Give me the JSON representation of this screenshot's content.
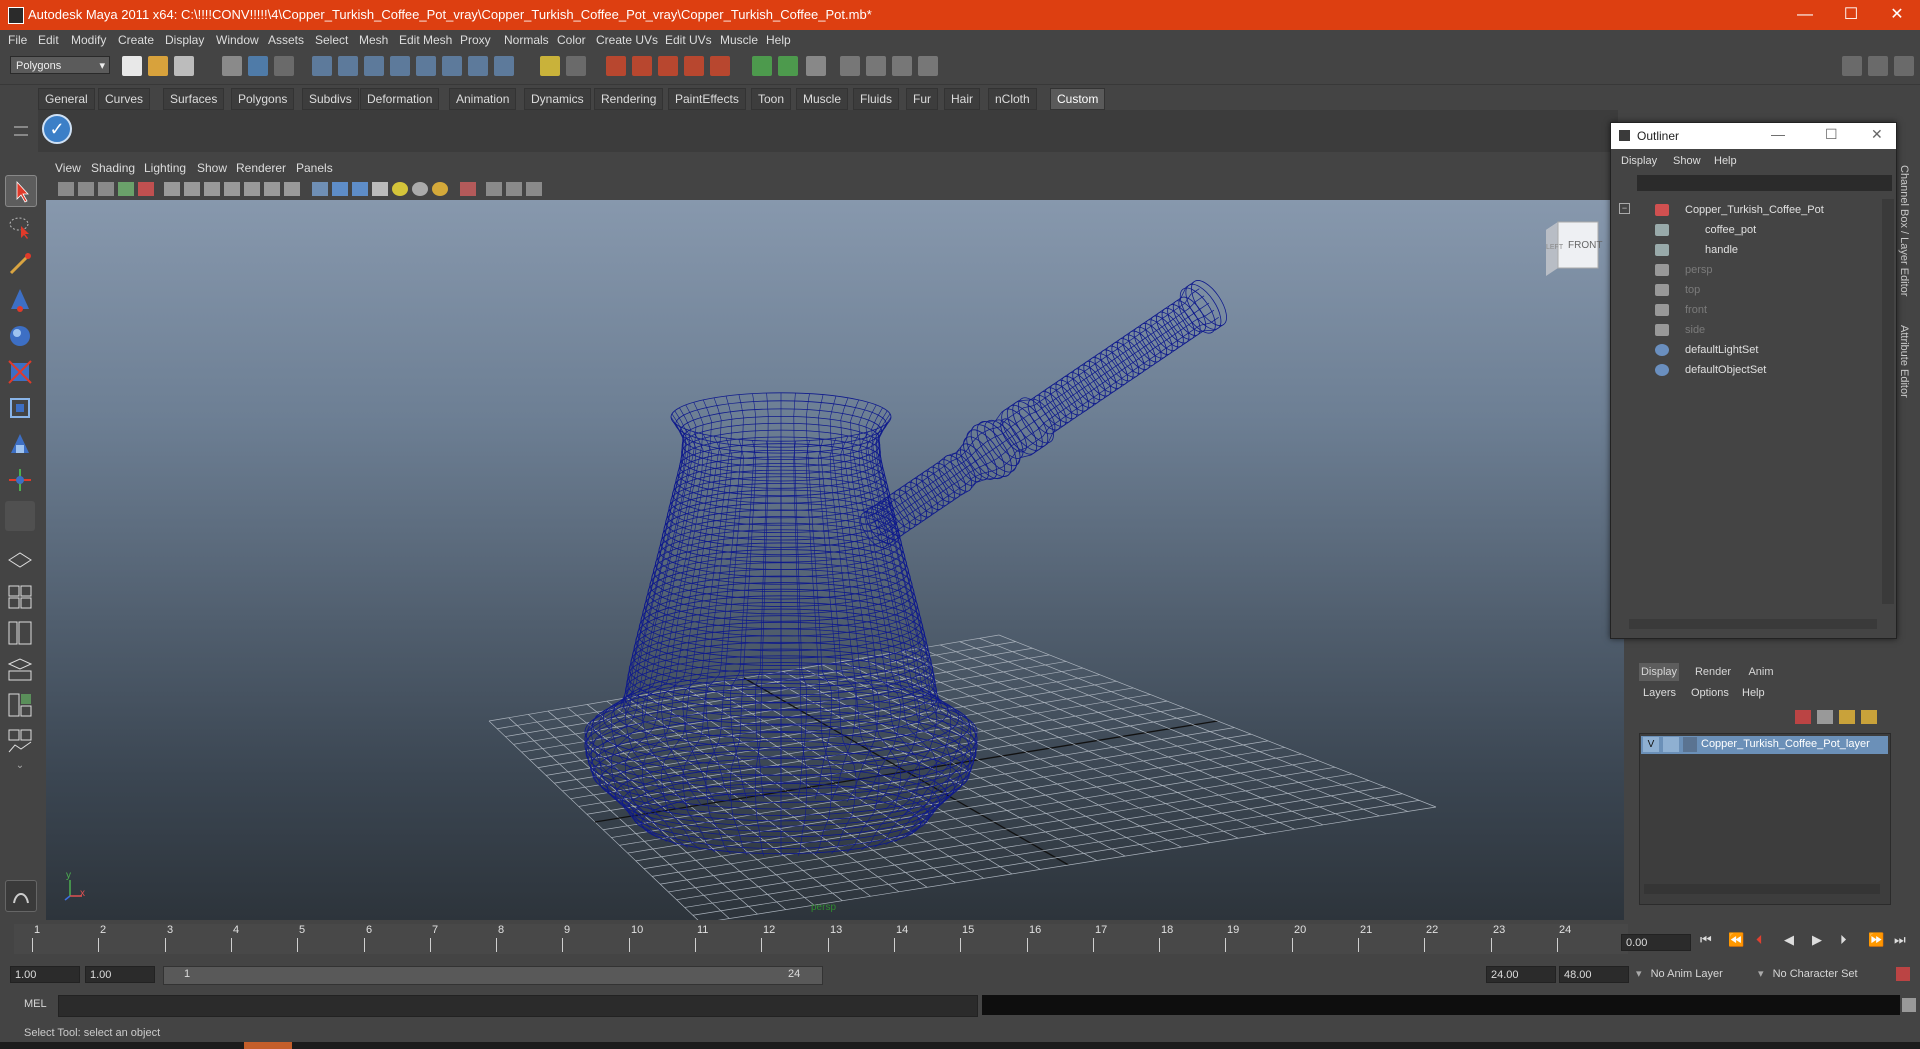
{
  "window": {
    "title": "Autodesk Maya 2011 x64: C:\\!!!!CONV!!!!!\\4\\Copper_Turkish_Coffee_Pot_vray\\Copper_Turkish_Coffee_Pot_vray\\Copper_Turkish_Coffee_Pot.mb*",
    "minimize": "—",
    "maximize": "☐",
    "close": "✕"
  },
  "menubar": [
    "File",
    "Edit",
    "Modify",
    "Create",
    "Display",
    "Window",
    "Assets",
    "Select",
    "Mesh",
    "Edit Mesh",
    "Proxy",
    "Normals",
    "Color",
    "Create UVs",
    "Edit UVs",
    "Muscle",
    "Help"
  ],
  "statusline": {
    "mode_selector": "Polygons"
  },
  "shelf": {
    "tabs": [
      "General",
      "Curves",
      "Surfaces",
      "Polygons",
      "Subdivs",
      "Deformation",
      "Animation",
      "Dynamics",
      "Rendering",
      "PaintEffects",
      "Toon",
      "Muscle",
      "Fluids",
      "Fur",
      "Hair",
      "nCloth",
      "Custom"
    ],
    "active_tab": "Custom"
  },
  "viewport": {
    "menus": [
      "View",
      "Shading",
      "Lighting",
      "Show",
      "Renderer",
      "Panels"
    ],
    "viewcube_label": "FRONT",
    "viewcube_side": "LEFT",
    "camera_label": "persp",
    "axis_x": "x",
    "axis_y": "y"
  },
  "outliner": {
    "title": "Outliner",
    "menus": [
      "Display",
      "Show",
      "Help"
    ],
    "items": [
      {
        "label": "Copper_Turkish_Coffee_Pot",
        "indent": 0,
        "dim": false,
        "icon": "group-icon"
      },
      {
        "label": "coffee_pot",
        "indent": 1,
        "dim": false,
        "icon": "mesh-icon"
      },
      {
        "label": "handle",
        "indent": 1,
        "dim": false,
        "icon": "mesh-icon"
      },
      {
        "label": "persp",
        "indent": 0,
        "dim": true,
        "icon": "camera-icon"
      },
      {
        "label": "top",
        "indent": 0,
        "dim": true,
        "icon": "camera-icon"
      },
      {
        "label": "front",
        "indent": 0,
        "dim": true,
        "icon": "camera-icon"
      },
      {
        "label": "side",
        "indent": 0,
        "dim": true,
        "icon": "camera-icon"
      },
      {
        "label": "defaultLightSet",
        "indent": 0,
        "dim": false,
        "icon": "set-icon"
      },
      {
        "label": "defaultObjectSet",
        "indent": 0,
        "dim": false,
        "icon": "set-icon"
      }
    ]
  },
  "side_tabs": {
    "channel_box": "Channel Box / Layer Editor",
    "attribute_editor": "Attribute Editor"
  },
  "layer_editor": {
    "tabs": [
      "Display",
      "Render",
      "Anim"
    ],
    "active_tab": "Display",
    "menus": [
      "Layers",
      "Options",
      "Help"
    ],
    "layer": {
      "visibility": "V",
      "name": "Copper_Turkish_Coffee_Pot_layer"
    }
  },
  "timeline": {
    "ticks": [
      "1",
      "2",
      "3",
      "4",
      "5",
      "6",
      "7",
      "8",
      "9",
      "10",
      "11",
      "12",
      "13",
      "14",
      "15",
      "16",
      "17",
      "18",
      "19",
      "20",
      "21",
      "22",
      "23",
      "24"
    ],
    "current_time": "0.00"
  },
  "range": {
    "start_time": "1.00",
    "playback_start": "1.00",
    "slider_start": "1",
    "slider_end": "24",
    "playback_end": "24.00",
    "end_time": "48.00",
    "anim_layer": "No Anim Layer",
    "character_set": "No Character Set"
  },
  "command_line": {
    "label": "MEL"
  },
  "help_line": "Select Tool: select an object",
  "colors": {
    "title_bar": "#dd3f11",
    "wireframe": "#0f1a8c",
    "selection": "#6b90b8"
  }
}
